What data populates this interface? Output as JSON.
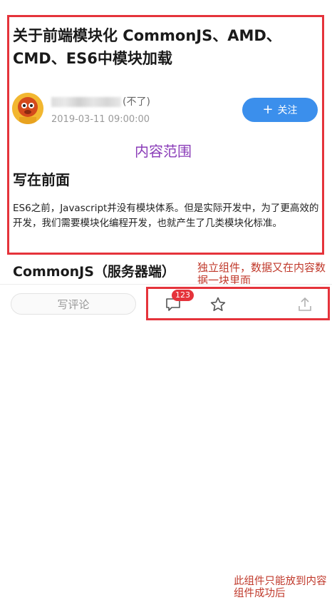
{
  "article": {
    "title": "关于前端模块化 CommonJS、AMD、CMD、ES6中模块加载",
    "author_suffix": "(不了)",
    "timestamp": "2019-03-11 09:00:00",
    "follow_label": "关注",
    "follow_icon": "plus-icon",
    "section_heading": "写在前面",
    "paragraph": "ES6之前，Javascript并没有模块体系。但是实际开发中，为了更高效的开发，我们需要模块化编程开发，也就产生了几类模块化标准。",
    "next_heading": "CommonJS（服务器端）"
  },
  "annotations": {
    "content_scope": "内容范围",
    "standalone_component": "独立组件，数据又在内容数据一块里面",
    "placement_note": "此组件只能放到内容组件成功后"
  },
  "bottom_bar": {
    "comment_placeholder": "写评论",
    "comment_count": "123",
    "icons": [
      "comment-icon",
      "star-icon",
      "share-icon"
    ]
  },
  "colors": {
    "annotation_red": "#e5333b",
    "annotation_purple": "#8a3cb8",
    "follow_blue": "#3b8fec"
  }
}
